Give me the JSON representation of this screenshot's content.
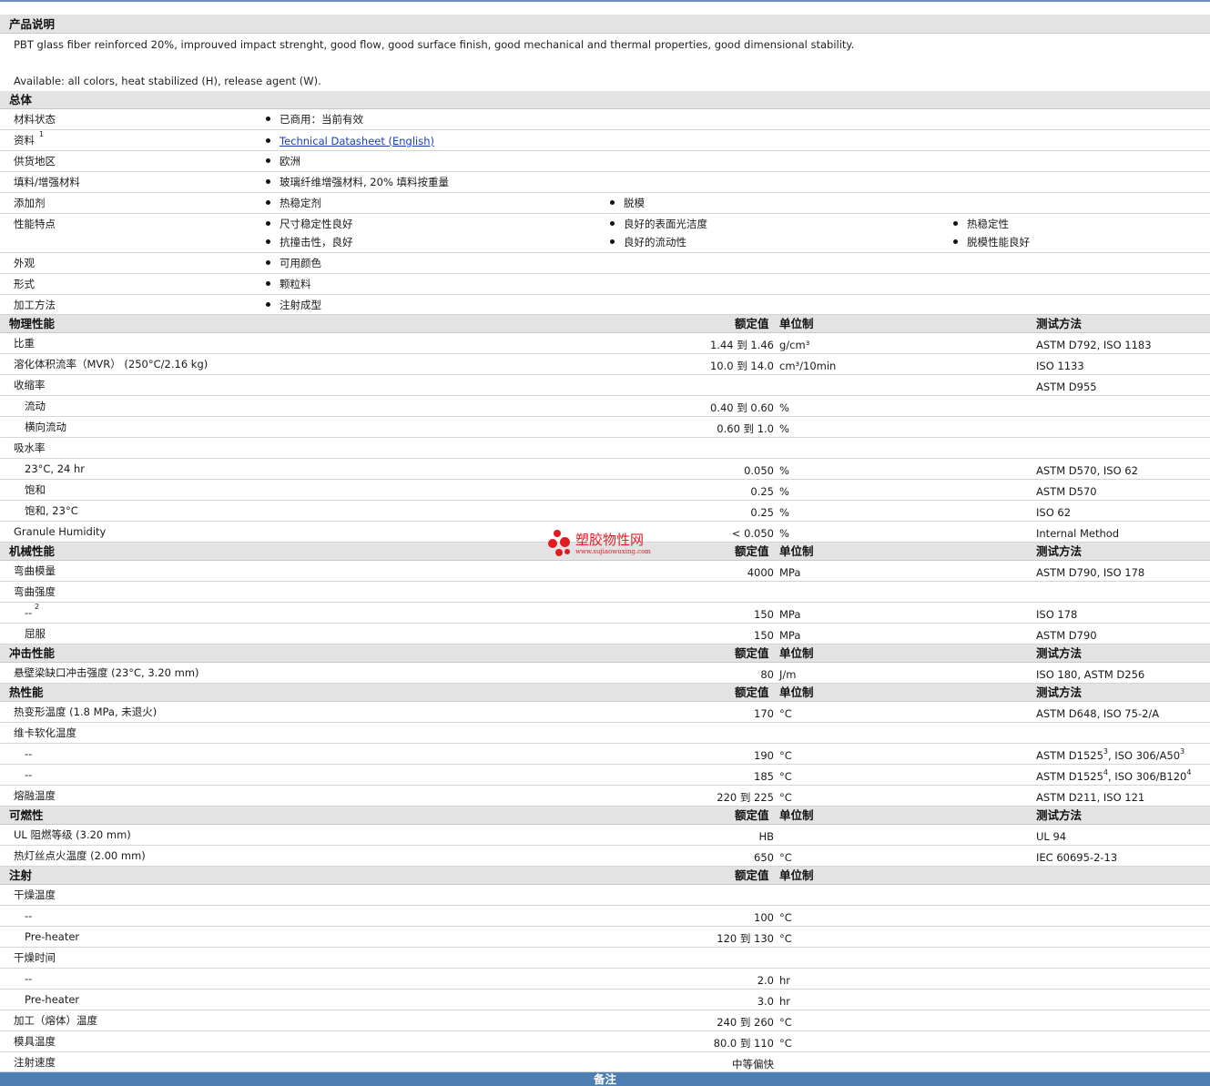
{
  "desc_section": {
    "title": "产品说明",
    "line1": "PBT glass fiber reinforced 20%, improuved impact strenght, good flow, good surface finish, good mechanical and thermal properties, good dimensional stability.",
    "line2": "Available: all colors, heat stabilized (H), release agent (W)."
  },
  "general": {
    "title": "总体",
    "rows": [
      {
        "label": "材料状态",
        "values": [
          "已商用：当前有效"
        ]
      },
      {
        "label": "资料",
        "sup": "1",
        "link": "Technical Datasheet (English)"
      },
      {
        "label": "供货地区",
        "values": [
          "欧洲"
        ]
      },
      {
        "label": "填料/增强材料",
        "values": [
          "玻璃纤维增强材料, 20% 填料按重量"
        ]
      },
      {
        "label": "添加剂",
        "values": [
          "热稳定剂",
          "脱模"
        ]
      },
      {
        "label": "性能特点",
        "col1": [
          "尺寸稳定性良好",
          "抗撞击性，良好"
        ],
        "col2": [
          "良好的表面光洁度",
          "良好的流动性"
        ],
        "col3": [
          "热稳定性",
          "脱模性能良好"
        ]
      },
      {
        "label": "外观",
        "values": [
          "可用颜色"
        ]
      },
      {
        "label": "形式",
        "values": [
          "颗粒料"
        ]
      },
      {
        "label": "加工方法",
        "values": [
          "注射成型"
        ]
      }
    ]
  },
  "headers": {
    "nominal": "额定值",
    "unit": "单位制",
    "method": "测试方法"
  },
  "physical": {
    "title": "物理性能",
    "rows": [
      {
        "label": "比重",
        "value": "1.44 到  1.46",
        "unit": "g/cm³",
        "method": "ASTM D792, ISO 1183"
      },
      {
        "label": "溶化体积流率（MVR） (250°C/2.16 kg)",
        "value": "10.0 到  14.0",
        "unit": "cm³/10min",
        "method": "ISO 1133"
      },
      {
        "label": "收缩率",
        "value": "",
        "unit": "",
        "method": "ASTM D955"
      },
      {
        "label": "流动",
        "indent": true,
        "value": "0.40 到  0.60",
        "unit": "%",
        "method": ""
      },
      {
        "label": "横向流动",
        "indent": true,
        "value": "0.60 到  1.0",
        "unit": "%",
        "method": ""
      },
      {
        "label": "吸水率",
        "value": "",
        "unit": "",
        "method": ""
      },
      {
        "label": "23°C, 24 hr",
        "indent": true,
        "value": "0.050",
        "unit": "%",
        "method": "ASTM D570, ISO 62"
      },
      {
        "label": "饱和",
        "indent": true,
        "value": "0.25",
        "unit": "%",
        "method": "ASTM D570"
      },
      {
        "label": "饱和, 23°C",
        "indent": true,
        "value": "0.25",
        "unit": "%",
        "method": "ISO 62"
      },
      {
        "label": "Granule Humidity",
        "value": "< 0.050",
        "unit": "%",
        "method": "Internal Method"
      }
    ]
  },
  "mechanical": {
    "title": "机械性能",
    "rows": [
      {
        "label": "弯曲模量",
        "value": "4000",
        "unit": "MPa",
        "method": "ASTM D790, ISO 178"
      },
      {
        "label": "弯曲强度",
        "value": "",
        "unit": "",
        "method": ""
      },
      {
        "label": "--",
        "sup": "2",
        "indent": true,
        "value": "150",
        "unit": "MPa",
        "method": "ISO 178"
      },
      {
        "label": "屈服",
        "indent": true,
        "value": "150",
        "unit": "MPa",
        "method": "ASTM D790"
      }
    ]
  },
  "impact": {
    "title": "冲击性能",
    "rows": [
      {
        "label": "悬壁梁缺口冲击强度 (23°C, 3.20 mm)",
        "value": "80",
        "unit": "J/m",
        "method": "ISO 180, ASTM D256"
      }
    ]
  },
  "thermal": {
    "title": "热性能",
    "rows": [
      {
        "label": "热变形温度 (1.8 MPa, 未退火)",
        "value": "170",
        "unit": "°C",
        "method": "ASTM D648, ISO 75-2/A"
      },
      {
        "label": "维卡软化温度",
        "value": "",
        "unit": "",
        "method": ""
      },
      {
        "label": "--",
        "indent": true,
        "value": "190",
        "unit": "°C",
        "method_a": "ASTM D1525",
        "sup_a": "3",
        "method_b": ", ISO 306/A50",
        "sup_b": "3"
      },
      {
        "label": "--",
        "indent": true,
        "value": "185",
        "unit": "°C",
        "method_a": "ASTM D1525",
        "sup_a": "4",
        "method_b": ", ISO 306/B120",
        "sup_b": "4"
      },
      {
        "label": "熔融温度",
        "value": "220 到  225",
        "unit": "°C",
        "method": "ASTM D211, ISO 121"
      }
    ]
  },
  "flammability": {
    "title": "可燃性",
    "rows": [
      {
        "label": "UL 阻燃等级 (3.20 mm)",
        "value": "HB",
        "unit": "",
        "method": "UL 94"
      },
      {
        "label": "热灯丝点火温度 (2.00 mm)",
        "value": "650",
        "unit": "°C",
        "method": "IEC 60695-2-13"
      }
    ]
  },
  "injection": {
    "title": "注射",
    "rows": [
      {
        "label": "干燥温度",
        "value": "",
        "unit": "",
        "method": ""
      },
      {
        "label": "--",
        "indent": true,
        "value": "100",
        "unit": "°C",
        "method": ""
      },
      {
        "label": "Pre-heater",
        "indent": true,
        "value": "120 到  130",
        "unit": "°C",
        "method": ""
      },
      {
        "label": "干燥时间",
        "value": "",
        "unit": "",
        "method": ""
      },
      {
        "label": "--",
        "indent": true,
        "value": "2.0",
        "unit": "hr",
        "method": ""
      },
      {
        "label": "Pre-heater",
        "indent": true,
        "value": "3.0",
        "unit": "hr",
        "method": ""
      },
      {
        "label": "加工（熔体）温度",
        "value": "240 到  260",
        "unit": "°C",
        "method": ""
      },
      {
        "label": "模具温度",
        "value": "80.0 到  110",
        "unit": "°C",
        "method": ""
      },
      {
        "label": "注射速度",
        "value": "中等偏快",
        "unit": "",
        "method": ""
      }
    ]
  },
  "footer": {
    "label": "备注"
  },
  "watermark": {
    "text": "塑胶物性网",
    "url": "www.sujiaowuxing.com"
  }
}
